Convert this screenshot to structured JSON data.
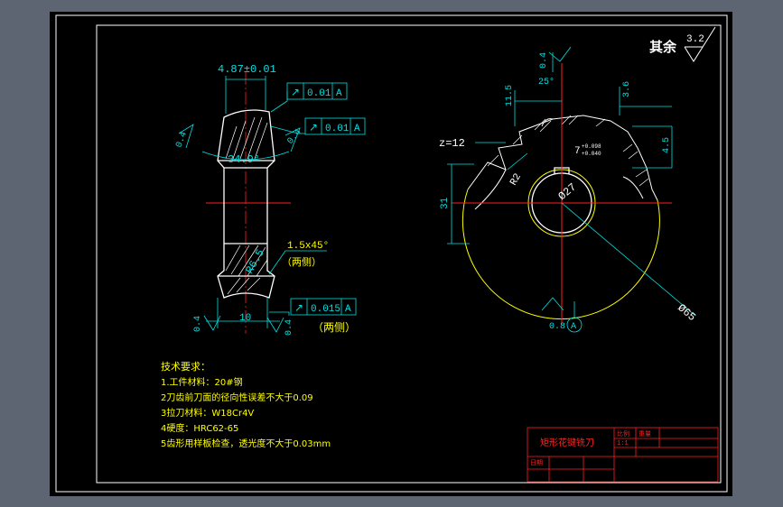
{
  "colors": {
    "background_chrome": "#5d6573",
    "canvas": "#000000",
    "outline": "#ffffff",
    "dimension": "#00e0e0",
    "centerline": "#ff2020",
    "note_text": "#ffff00",
    "datum_blue": "#4040ff",
    "hatch": "#ffffff"
  },
  "icons": {
    "surface_finish": "surface-finish-triangle-icon",
    "datum": "datum-circle-icon",
    "gdt_runout": "runout-arrow-icon"
  },
  "roughness_default": {
    "label": "其余",
    "value": "3.2"
  },
  "side_view": {
    "width_tolerance": "4.87±0.01",
    "angle": "34.9°",
    "chamfer": "1.5x45°",
    "chamfer_note": "（两侧）",
    "fillet": "R6.5",
    "thickness": "10",
    "roughness_left_top": "0.4",
    "roughness_right_top": "0.4",
    "roughness_left_bottom": "0.4",
    "roughness_right_bottom": "0.4",
    "gdt_1": {
      "symbol": "↗",
      "tolerance": "0.01",
      "datum": "A"
    },
    "gdt_2": {
      "symbol": "↗",
      "tolerance": "0.01",
      "datum": "A"
    },
    "gdt_3": {
      "symbol": "↗",
      "tolerance": "0.015",
      "datum": "A"
    },
    "gdt_3_note": "（两侧）"
  },
  "front_view": {
    "tooth_count": "z=12",
    "roughness_top": "0.4",
    "rake_angle": "25°",
    "dim_11_5": "11.5",
    "dim_3_6": "3.6",
    "dim_4_5": "4.5",
    "keyway_width": "7",
    "keyway_tol_upper": "+0.098",
    "keyway_tol_lower": "+0.040",
    "radius": "R2",
    "bore": "Ø27",
    "height": "31",
    "outer_dia": "Ø65",
    "roughness_bottom": "0.8",
    "datum": "A"
  },
  "notes": {
    "heading": "技术要求：",
    "lines": [
      "1.工件材料：20#钢",
      "2刀齿前刀面的径向性误差不大于0.09",
      "3拉刀材料：W18Cr4V",
      "4硬度：HRC62-65",
      "5齿形用样板检查，透光度不大于0.03mm"
    ]
  },
  "title_block": {
    "part_name": "矩形花键铣刀",
    "ratio_label": "比例",
    "ratio_value": "1:1",
    "weight_label": "重量",
    "date_label": "日期"
  }
}
